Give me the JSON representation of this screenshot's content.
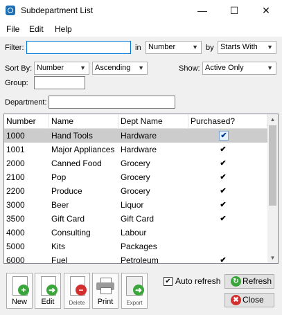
{
  "window": {
    "title": "Subdepartment List"
  },
  "menu": [
    "File",
    "Edit",
    "Help"
  ],
  "filter": {
    "label": "Filter:",
    "value": "",
    "in_label": "in",
    "field": "Number",
    "by_label": "by",
    "match": "Starts With"
  },
  "sort": {
    "label": "Sort By:",
    "field": "Number",
    "order": "Ascending",
    "show_label": "Show:",
    "show": "Active Only"
  },
  "group": {
    "label": "Group:",
    "value": ""
  },
  "department": {
    "label": "Department:",
    "value": ""
  },
  "grid": {
    "columns": [
      "Number",
      "Name",
      "Dept Name",
      "Purchased?"
    ],
    "rows": [
      {
        "number": "1000",
        "name": "Hand Tools",
        "dept": "Hardware",
        "purchased": true
      },
      {
        "number": "1001",
        "name": "Major Appliances",
        "dept": "Hardware",
        "purchased": true
      },
      {
        "number": "2000",
        "name": "Canned Food",
        "dept": "Grocery",
        "purchased": true
      },
      {
        "number": "2100",
        "name": "Pop",
        "dept": "Grocery",
        "purchased": true
      },
      {
        "number": "2200",
        "name": "Produce",
        "dept": "Grocery",
        "purchased": true
      },
      {
        "number": "3000",
        "name": "Beer",
        "dept": "Liquor",
        "purchased": true
      },
      {
        "number": "3500",
        "name": "Gift Card",
        "dept": "Gift Card",
        "purchased": true
      },
      {
        "number": "4000",
        "name": "Consulting",
        "dept": "Labour",
        "purchased": false
      },
      {
        "number": "5000",
        "name": "Kits",
        "dept": "Packages",
        "purchased": false
      },
      {
        "number": "6000",
        "name": "Fuel",
        "dept": "Petroleum",
        "purchased": true
      }
    ],
    "check_glyph": "✔"
  },
  "toolbar": {
    "new_label": "New",
    "edit_label": "Edit",
    "delete_label": "Delete",
    "print_label": "Print",
    "export_label": "Export"
  },
  "auto_refresh": {
    "label": "Auto refresh",
    "checked": true,
    "glyph": "✔"
  },
  "buttons": {
    "refresh_label": "Refresh",
    "close_label": "Close"
  },
  "colors": {
    "accent_green": "#3aa53a",
    "accent_red": "#d32f2f",
    "selection": "#cccccc"
  }
}
